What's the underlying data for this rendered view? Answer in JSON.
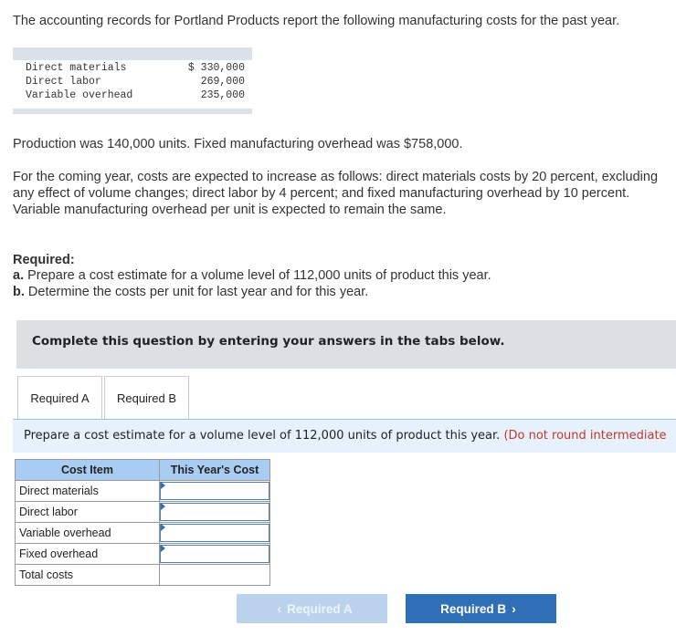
{
  "intro": "The accounting records for Portland Products report the following manufacturing costs for the past year.",
  "costs": [
    {
      "label": "Direct materials",
      "value": "$ 330,000"
    },
    {
      "label": "Direct labor",
      "value": "269,000"
    },
    {
      "label": "Variable overhead",
      "value": "235,000"
    }
  ],
  "production": "Production was 140,000 units. Fixed manufacturing overhead was $758,000.",
  "forecast": "For the coming year, costs are expected to increase as follows: direct materials costs by 20 percent, excluding any effect of volume changes; direct labor by 4 percent; and fixed manufacturing overhead by 10 percent. Variable manufacturing overhead per unit is expected to remain the same.",
  "required": {
    "heading": "Required:",
    "a_label": "a.",
    "a_text": " Prepare a cost estimate for a volume level of 112,000 units of product this year.",
    "b_label": "b.",
    "b_text": " Determine the costs per unit for last year and for this year."
  },
  "instruction": "Complete this question by entering your answers in the tabs below.",
  "tabs": [
    "Required A",
    "Required B"
  ],
  "prompt": {
    "main": "Prepare a cost estimate for a volume level of 112,000 units of product this year.",
    "note": "(Do not round intermediate"
  },
  "table": {
    "headers": [
      "Cost Item",
      "This Year's Cost"
    ],
    "rows": [
      "Direct materials",
      "Direct labor",
      "Variable overhead",
      "Fixed overhead",
      "Total costs"
    ]
  },
  "nav": {
    "prev": "Required A",
    "next": "Required B"
  }
}
